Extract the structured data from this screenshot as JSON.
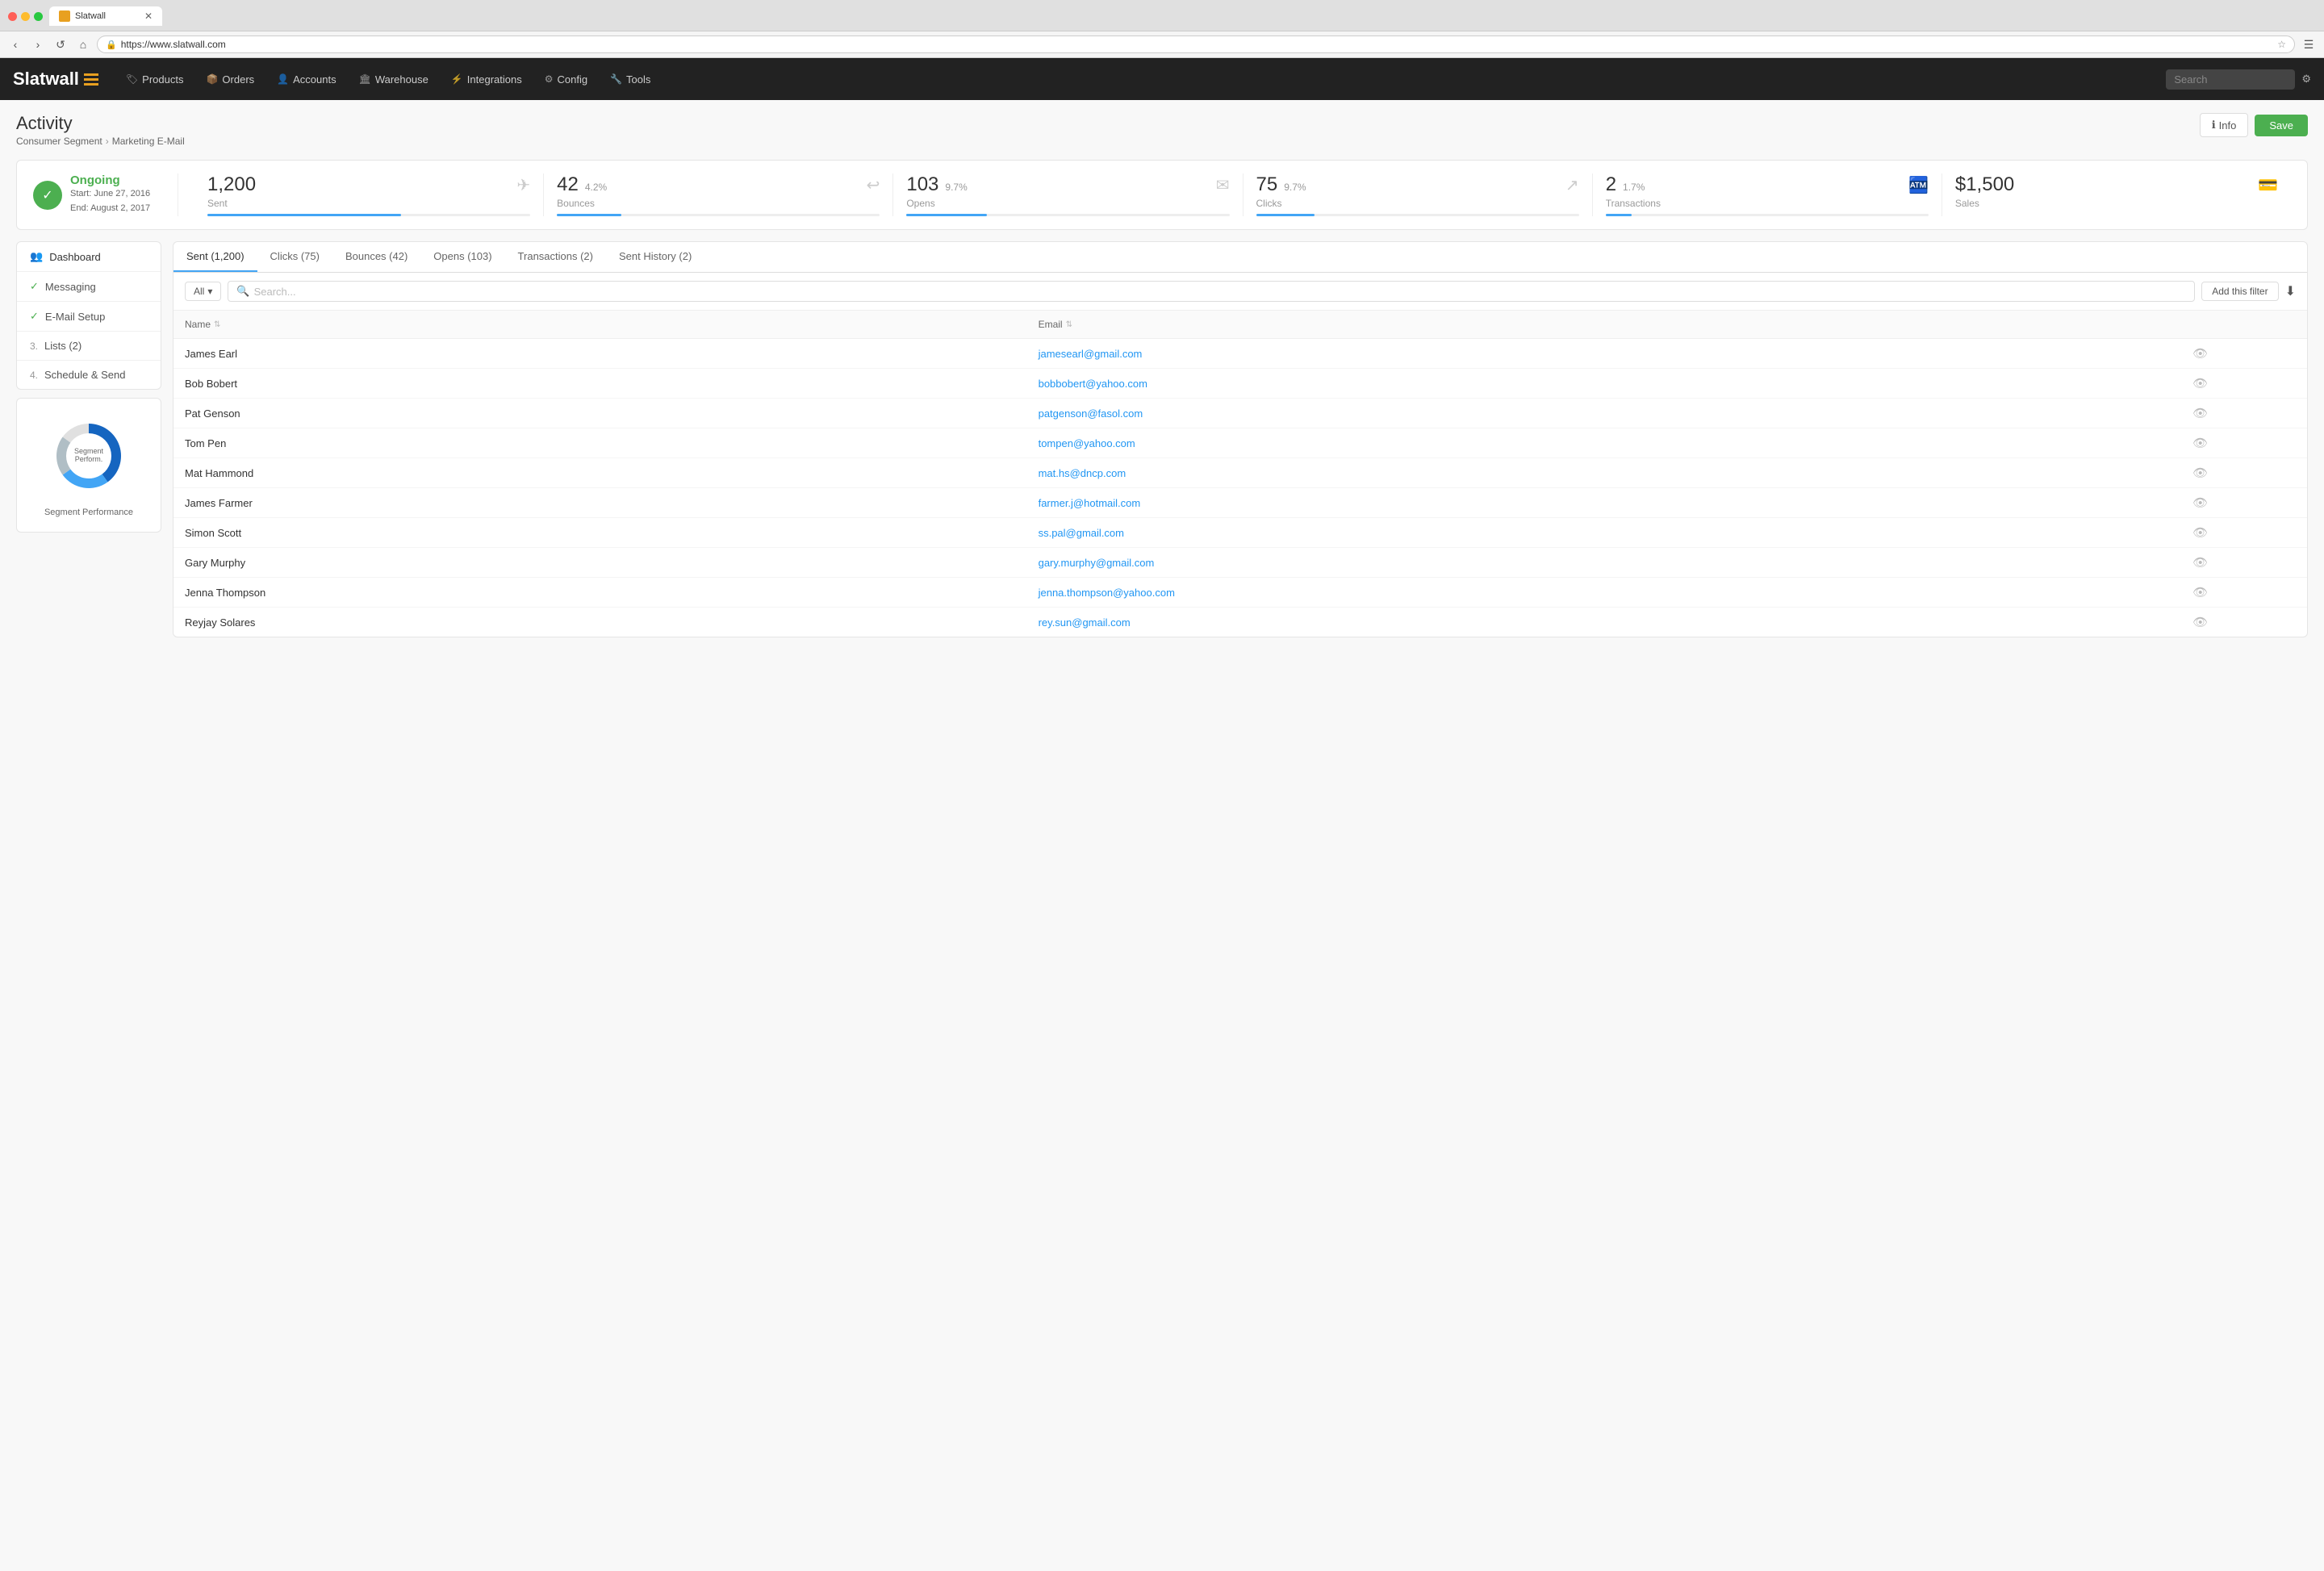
{
  "browser": {
    "tab_title": "Slatwall",
    "url": "https://www.slatwall.com"
  },
  "nav": {
    "logo": "Slatwall",
    "items": [
      {
        "label": "Products",
        "icon": "🏷"
      },
      {
        "label": "Orders",
        "icon": "📦"
      },
      {
        "label": "Accounts",
        "icon": "👤"
      },
      {
        "label": "Warehouse",
        "icon": "🏛"
      },
      {
        "label": "Integrations",
        "icon": "⚡"
      },
      {
        "label": "Config",
        "icon": "⚙"
      },
      {
        "label": "Tools",
        "icon": "🔧"
      }
    ],
    "search_placeholder": "Search"
  },
  "page": {
    "title": "Activity",
    "breadcrumb_parent": "Consumer Segment",
    "breadcrumb_child": "Marketing E-Mail",
    "btn_info": "Info",
    "btn_save": "Save"
  },
  "status": {
    "label": "Ongoing",
    "start": "Start: June 27, 2016",
    "end": "End: August 2, 2017"
  },
  "stats": [
    {
      "value": "1,200",
      "pct": "",
      "label": "Sent",
      "bar": 60,
      "icon": "✈"
    },
    {
      "value": "42",
      "pct": "4.2%",
      "label": "Bounces",
      "bar": 20,
      "icon": "↩"
    },
    {
      "value": "103",
      "pct": "9.7%",
      "label": "Opens",
      "bar": 25,
      "icon": "✉"
    },
    {
      "value": "75",
      "pct": "9.7%",
      "label": "Clicks",
      "bar": 18,
      "icon": "↗"
    },
    {
      "value": "2",
      "pct": "1.7%",
      "label": "Transactions",
      "bar": 8,
      "icon": "🏧"
    },
    {
      "value": "$1,500",
      "pct": "",
      "label": "Sales",
      "icon": "💳"
    }
  ],
  "sidebar": {
    "items": [
      {
        "label": "Dashboard",
        "type": "icon",
        "check": false,
        "number": ""
      },
      {
        "label": "Messaging",
        "type": "check",
        "check": true,
        "number": ""
      },
      {
        "label": "E-Mail Setup",
        "type": "check",
        "check": true,
        "number": ""
      },
      {
        "label": "Lists (2)",
        "type": "number",
        "check": false,
        "number": "3."
      },
      {
        "label": "Schedule & Send",
        "type": "number",
        "check": false,
        "number": "4."
      }
    ],
    "donut_label": "Segment Performance"
  },
  "tabs": [
    {
      "label": "Sent (1,200)",
      "active": true
    },
    {
      "label": "Clicks (75)",
      "active": false
    },
    {
      "label": "Bounces (42)",
      "active": false
    },
    {
      "label": "Opens (103)",
      "active": false
    },
    {
      "label": "Transactions (2)",
      "active": false
    },
    {
      "label": "Sent History (2)",
      "active": false
    }
  ],
  "table": {
    "filter_label": "All",
    "search_placeholder": "Search...",
    "add_filter_label": "Add this filter",
    "columns": [
      {
        "label": "Name"
      },
      {
        "label": "Email"
      }
    ],
    "rows": [
      {
        "name": "James Earl",
        "email": "jamesearl@gmail.com"
      },
      {
        "name": "Bob Bobert",
        "email": "bobbobert@yahoo.com"
      },
      {
        "name": "Pat Genson",
        "email": "patgenson@fasol.com"
      },
      {
        "name": "Tom Pen",
        "email": "tompen@yahoo.com"
      },
      {
        "name": "Mat Hammond",
        "email": "mat.hs@dncp.com"
      },
      {
        "name": "James Farmer",
        "email": "farmer.j@hotmail.com"
      },
      {
        "name": "Simon Scott",
        "email": "ss.pal@gmail.com"
      },
      {
        "name": "Gary Murphy",
        "email": "gary.murphy@gmail.com"
      },
      {
        "name": "Jenna Thompson",
        "email": "jenna.thompson@yahoo.com"
      },
      {
        "name": "Reyjay Solares",
        "email": "rey.sun@gmail.com"
      }
    ]
  },
  "donut": {
    "segments": [
      {
        "color": "#1565c0",
        "pct": 40
      },
      {
        "color": "#42a5f5",
        "pct": 25
      },
      {
        "color": "#b0bec5",
        "pct": 20
      },
      {
        "color": "#e0e0e0",
        "pct": 15
      }
    ]
  }
}
